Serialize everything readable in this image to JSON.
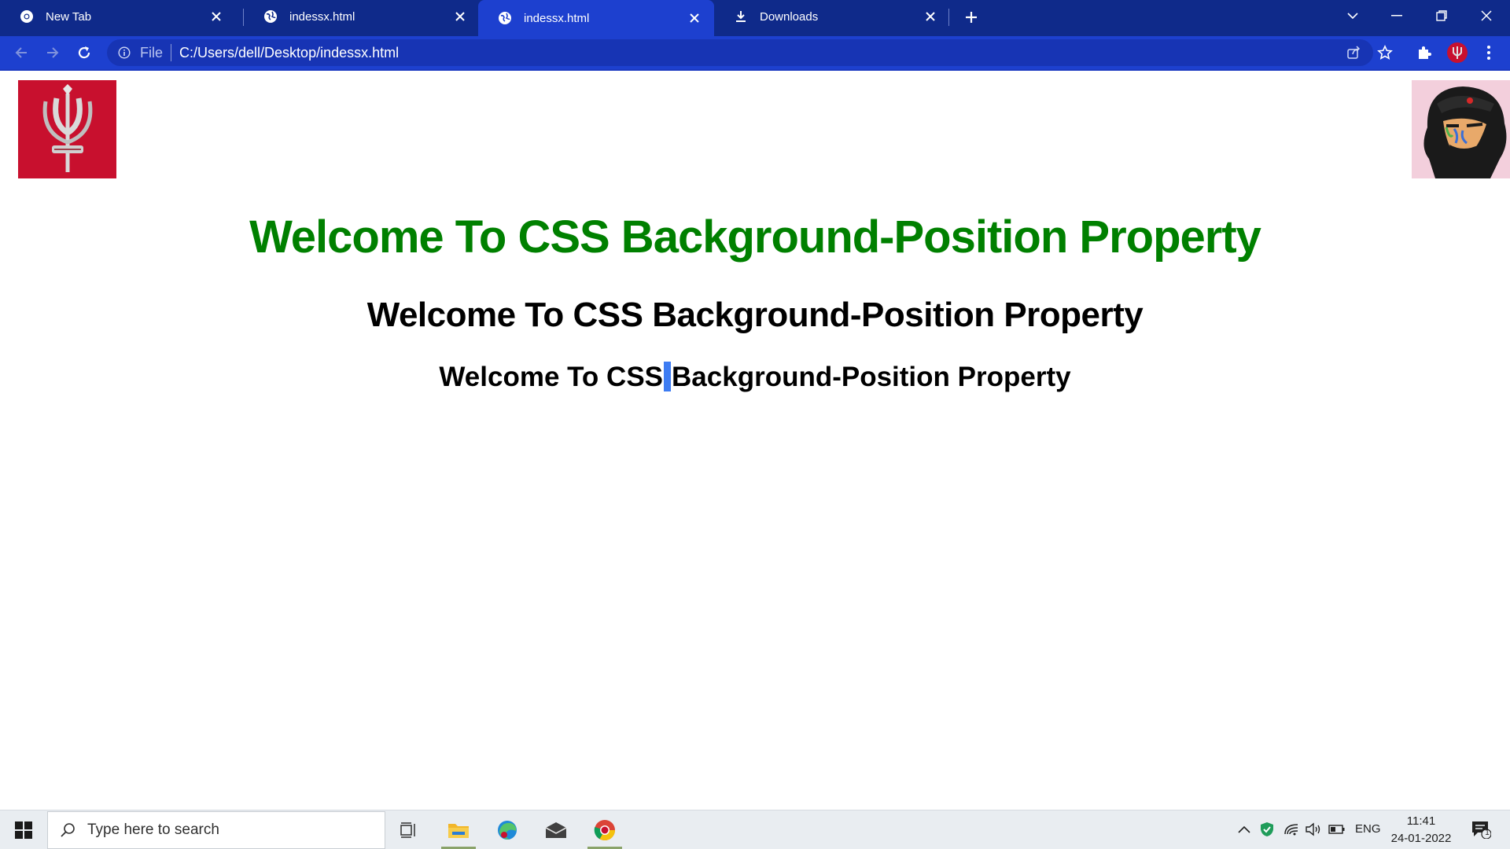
{
  "browser": {
    "tabs": [
      {
        "title": "New Tab",
        "icon": "chrome-icon",
        "active": false
      },
      {
        "title": "indessx.html",
        "icon": "globe-icon",
        "active": false
      },
      {
        "title": "indessx.html",
        "icon": "globe-icon",
        "active": true
      },
      {
        "title": "Downloads",
        "icon": "download-icon",
        "active": false
      }
    ],
    "address": {
      "scheme_label": "File",
      "url": "C:/Users/dell/Desktop/indessx.html"
    }
  },
  "page": {
    "heading1": "Welcome To CSS Background-Position Property",
    "heading2": "Welcome To CSS Background-Position Property",
    "heading3_before": "Welcome To CSS",
    "heading3_after": "Background-Position Property",
    "heading1_color": "#008000"
  },
  "taskbar": {
    "search_placeholder": "Type here to search",
    "language": "ENG",
    "time": "11:41",
    "date": "24-01-2022",
    "notification_count": "1"
  },
  "colors": {
    "tabstrip": "#0f2a8a",
    "toolbar": "#1d40cf",
    "logo_left": "#c8102e"
  }
}
